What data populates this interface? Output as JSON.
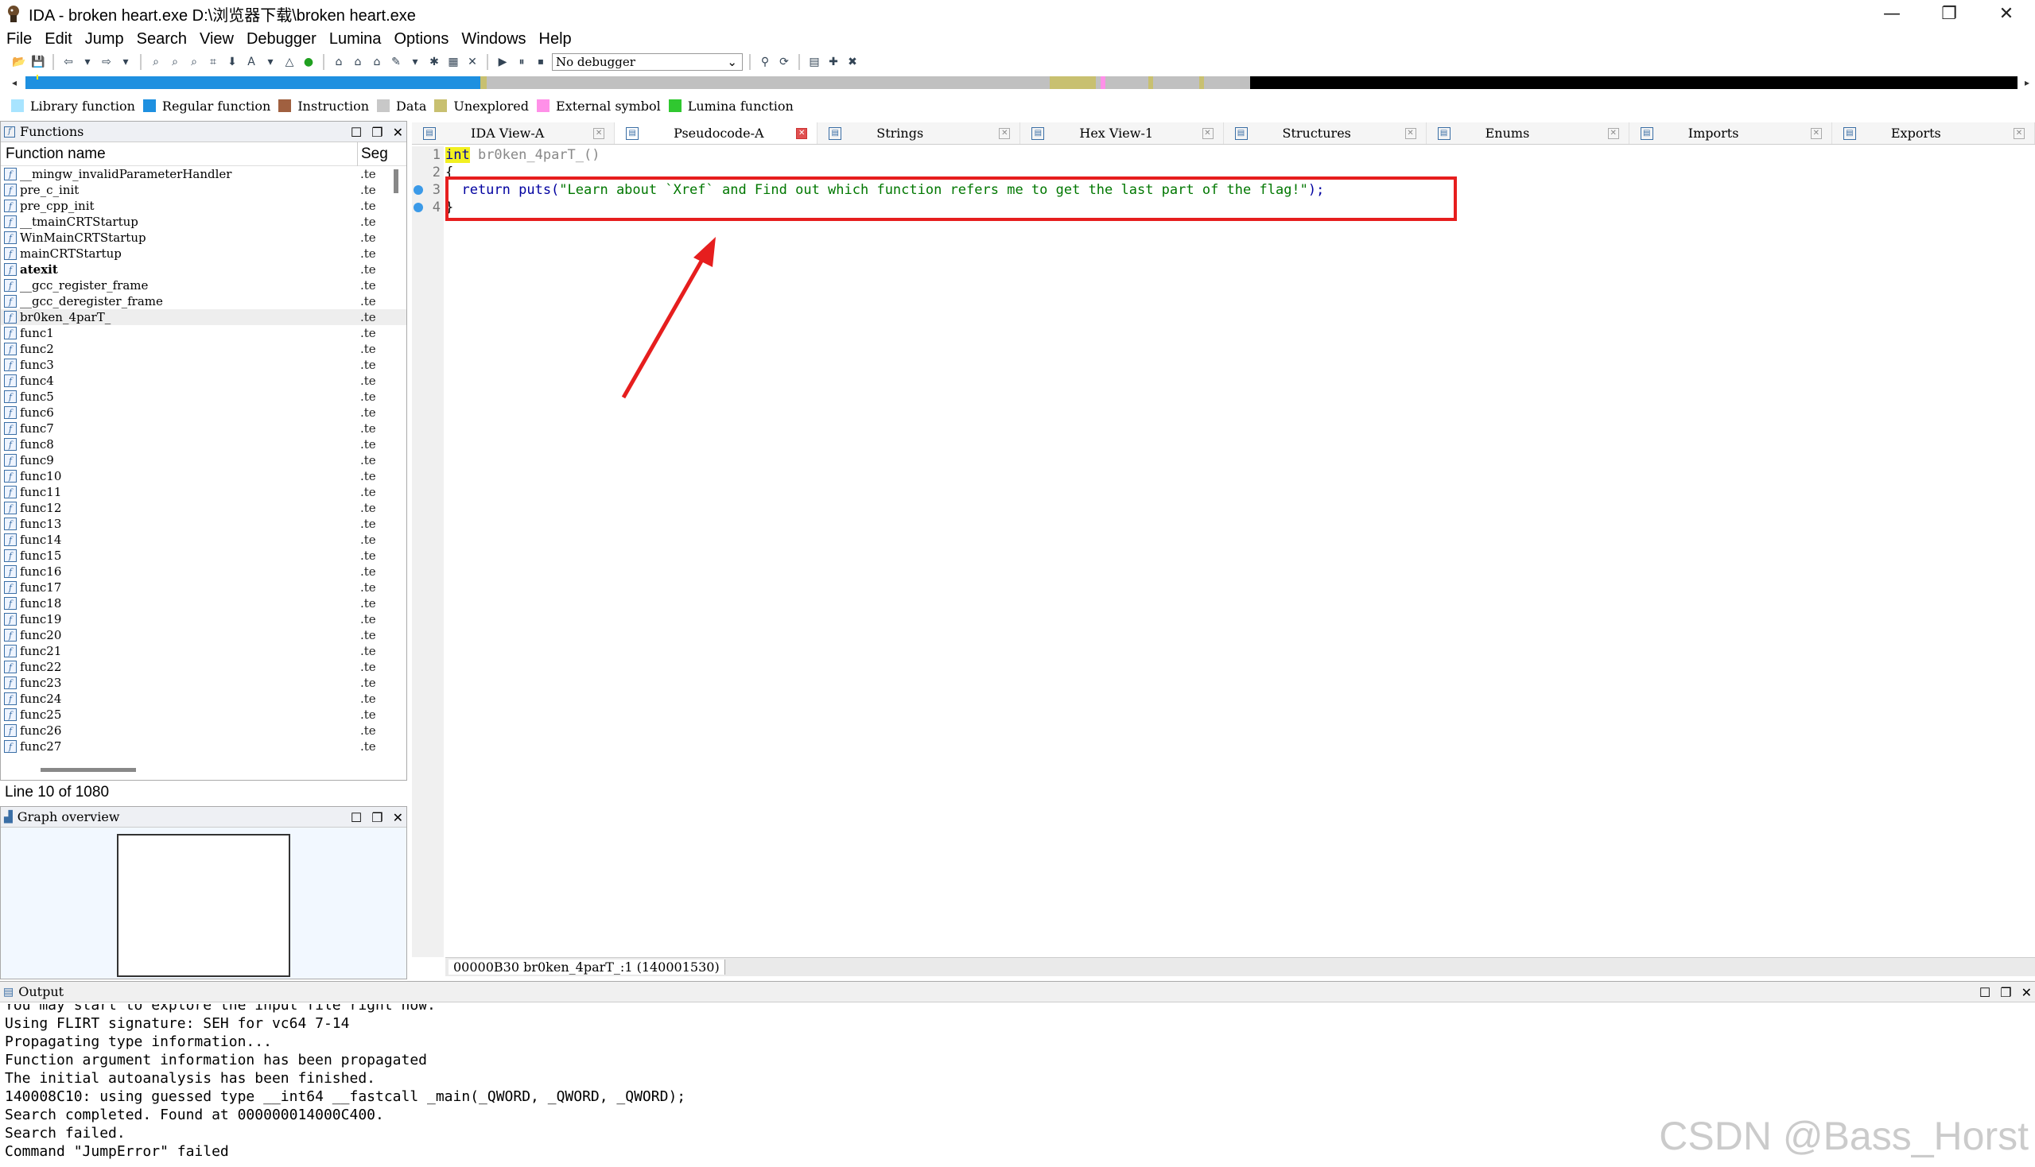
{
  "window": {
    "title": "IDA - broken heart.exe D:\\浏览器下载\\broken heart.exe",
    "minimize": "—",
    "restore": "❐",
    "close": "✕"
  },
  "menu": [
    "File",
    "Edit",
    "Jump",
    "Search",
    "View",
    "Debugger",
    "Lumina",
    "Options",
    "Windows",
    "Help"
  ],
  "toolbar": {
    "debugger_select": "No debugger"
  },
  "legend": [
    {
      "label": "Library function",
      "color": "#a8e4ff"
    },
    {
      "label": "Regular function",
      "color": "#1e90e0"
    },
    {
      "label": "Instruction",
      "color": "#a06040"
    },
    {
      "label": "Data",
      "color": "#c8c8c8"
    },
    {
      "label": "Unexplored",
      "color": "#c8c070"
    },
    {
      "label": "External symbol",
      "color": "#ff90e8"
    },
    {
      "label": "Lumina function",
      "color": "#30c830"
    }
  ],
  "functions_panel": {
    "title": "Functions",
    "col_name": "Function name",
    "col_seg": "Seg",
    "rows": [
      {
        "name": "__mingw_invalidParameterHandler",
        "seg": ".te"
      },
      {
        "name": "pre_c_init",
        "seg": ".te"
      },
      {
        "name": "pre_cpp_init",
        "seg": ".te"
      },
      {
        "name": "__tmainCRTStartup",
        "seg": ".te"
      },
      {
        "name": "WinMainCRTStartup",
        "seg": ".te"
      },
      {
        "name": "mainCRTStartup",
        "seg": ".te"
      },
      {
        "name": "atexit",
        "seg": ".te"
      },
      {
        "name": "__gcc_register_frame",
        "seg": ".te"
      },
      {
        "name": "__gcc_deregister_frame",
        "seg": ".te"
      },
      {
        "name": "br0ken_4parT_",
        "seg": ".te"
      },
      {
        "name": "func1",
        "seg": ".te"
      },
      {
        "name": "func2",
        "seg": ".te"
      },
      {
        "name": "func3",
        "seg": ".te"
      },
      {
        "name": "func4",
        "seg": ".te"
      },
      {
        "name": "func5",
        "seg": ".te"
      },
      {
        "name": "func6",
        "seg": ".te"
      },
      {
        "name": "func7",
        "seg": ".te"
      },
      {
        "name": "func8",
        "seg": ".te"
      },
      {
        "name": "func9",
        "seg": ".te"
      },
      {
        "name": "func10",
        "seg": ".te"
      },
      {
        "name": "func11",
        "seg": ".te"
      },
      {
        "name": "func12",
        "seg": ".te"
      },
      {
        "name": "func13",
        "seg": ".te"
      },
      {
        "name": "func14",
        "seg": ".te"
      },
      {
        "name": "func15",
        "seg": ".te"
      },
      {
        "name": "func16",
        "seg": ".te"
      },
      {
        "name": "func17",
        "seg": ".te"
      },
      {
        "name": "func18",
        "seg": ".te"
      },
      {
        "name": "func19",
        "seg": ".te"
      },
      {
        "name": "func20",
        "seg": ".te"
      },
      {
        "name": "func21",
        "seg": ".te"
      },
      {
        "name": "func22",
        "seg": ".te"
      },
      {
        "name": "func23",
        "seg": ".te"
      },
      {
        "name": "func24",
        "seg": ".te"
      },
      {
        "name": "func25",
        "seg": ".te"
      },
      {
        "name": "func26",
        "seg": ".te"
      },
      {
        "name": "func27",
        "seg": ".te"
      }
    ],
    "status": "Line 10 of 1080"
  },
  "graph_panel": {
    "title": "Graph overview"
  },
  "tabs": [
    {
      "label": "IDA View-A",
      "icon": "disasm-icon",
      "active": false
    },
    {
      "label": "Pseudocode-A",
      "icon": "pseudocode-icon",
      "active": true
    },
    {
      "label": "Strings",
      "icon": "strings-icon",
      "active": false
    },
    {
      "label": "Hex View-1",
      "icon": "hex-icon",
      "active": false
    },
    {
      "label": "Structures",
      "icon": "structures-icon",
      "active": false
    },
    {
      "label": "Enums",
      "icon": "enums-icon",
      "active": false
    },
    {
      "label": "Imports",
      "icon": "imports-icon",
      "active": false
    },
    {
      "label": "Exports",
      "icon": "exports-icon",
      "active": false
    }
  ],
  "pseudocode": {
    "line1_num": "1",
    "line1_kw": "int",
    "line1_rest": " br0ken_4parT_()",
    "line2_num": "2",
    "line2": "{",
    "line3_num": "3",
    "line3_kw": "  return puts(",
    "line3_str": "\"Learn about `Xref` and Find out which function refers me to get the last part of the flag!\"",
    "line3_end": ");",
    "line4_num": "4",
    "line4": "}",
    "status": "00000B30 br0ken_4parT_:1 (140001530)"
  },
  "output_panel": {
    "title": "Output",
    "lines": [
      "You may start to explore the input file right now.",
      "Using FLIRT signature: SEH for vc64 7-14",
      "Propagating type information...",
      "Function argument information has been propagated",
      "The initial autoanalysis has been finished.",
      "140008C10: using guessed type __int64 __fastcall _main(_QWORD, _QWORD, _QWORD);",
      "Search completed. Found at 000000014000C400.",
      "Search failed.",
      "Command \"JumpError\" failed"
    ]
  },
  "watermark": "CSDN @Bass_Horst",
  "annotation_color": "#e61e1e"
}
